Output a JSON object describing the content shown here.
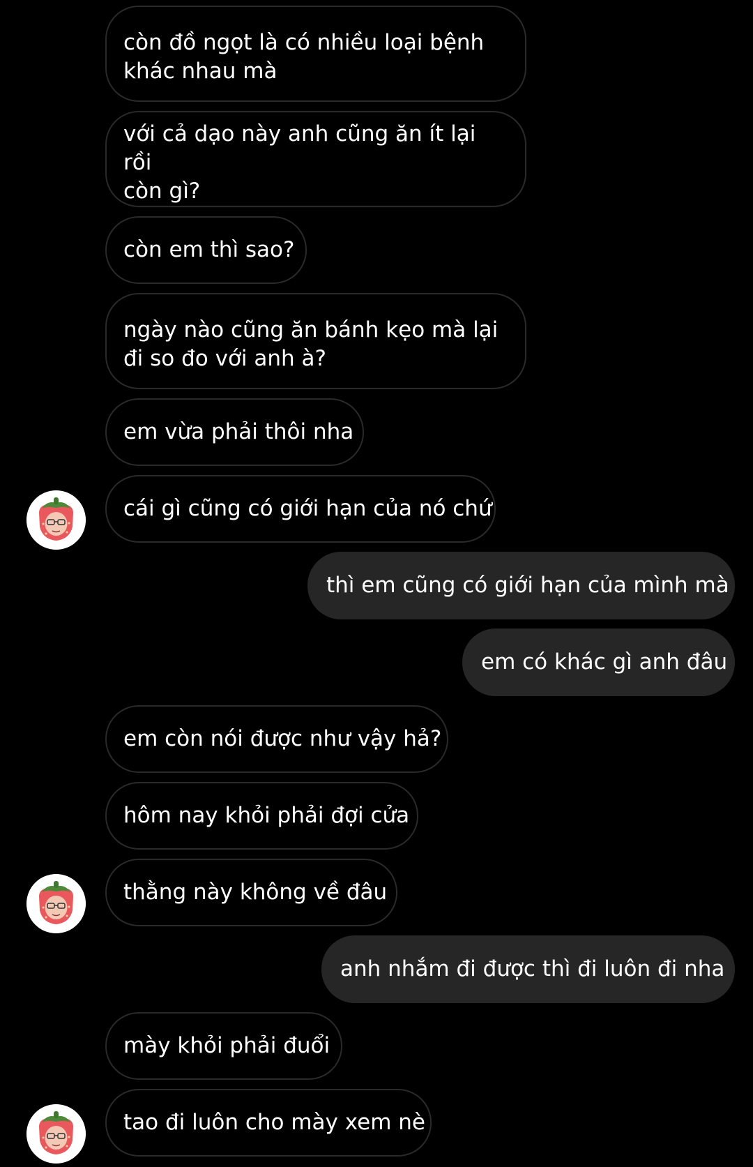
{
  "conversation": {
    "messages": [
      {
        "sender": "them",
        "text": "còn đồ ngọt là có nhiều loại bệnh\nkhác nhau mà"
      },
      {
        "sender": "them",
        "text": "với cả dạo này anh cũng ăn ít lại rồi\ncòn gì?"
      },
      {
        "sender": "them",
        "text": "còn em thì sao?"
      },
      {
        "sender": "them",
        "text": "ngày nào cũng ăn bánh kẹo mà lại\nđi so đo với anh à?"
      },
      {
        "sender": "them",
        "text": "em vừa phải thôi nha"
      },
      {
        "sender": "them",
        "text": "cái gì cũng có giới hạn của nó chứ"
      },
      {
        "sender": "me",
        "text": "thì em cũng có giới hạn của mình mà"
      },
      {
        "sender": "me",
        "text": "em có khác gì anh đâu"
      },
      {
        "sender": "them",
        "text": "em còn nói được như vậy hả?"
      },
      {
        "sender": "them",
        "text": "hôm nay khỏi phải đợi cửa"
      },
      {
        "sender": "them",
        "text": "thằng này không về đâu"
      },
      {
        "sender": "me",
        "text": "anh nhắm đi được thì đi luôn đi nha"
      },
      {
        "sender": "them",
        "text": "mày khỏi phải đuổi"
      },
      {
        "sender": "them",
        "text": "tao đi luôn cho mày xem nè"
      }
    ],
    "avatar_icon": "strawberry-character-avatar-icon",
    "colors": {
      "background": "#000000",
      "incoming_bubble": "#000000",
      "incoming_border": "#2a2a2a",
      "outgoing_bubble": "#262626",
      "text": "#ffffff"
    }
  }
}
